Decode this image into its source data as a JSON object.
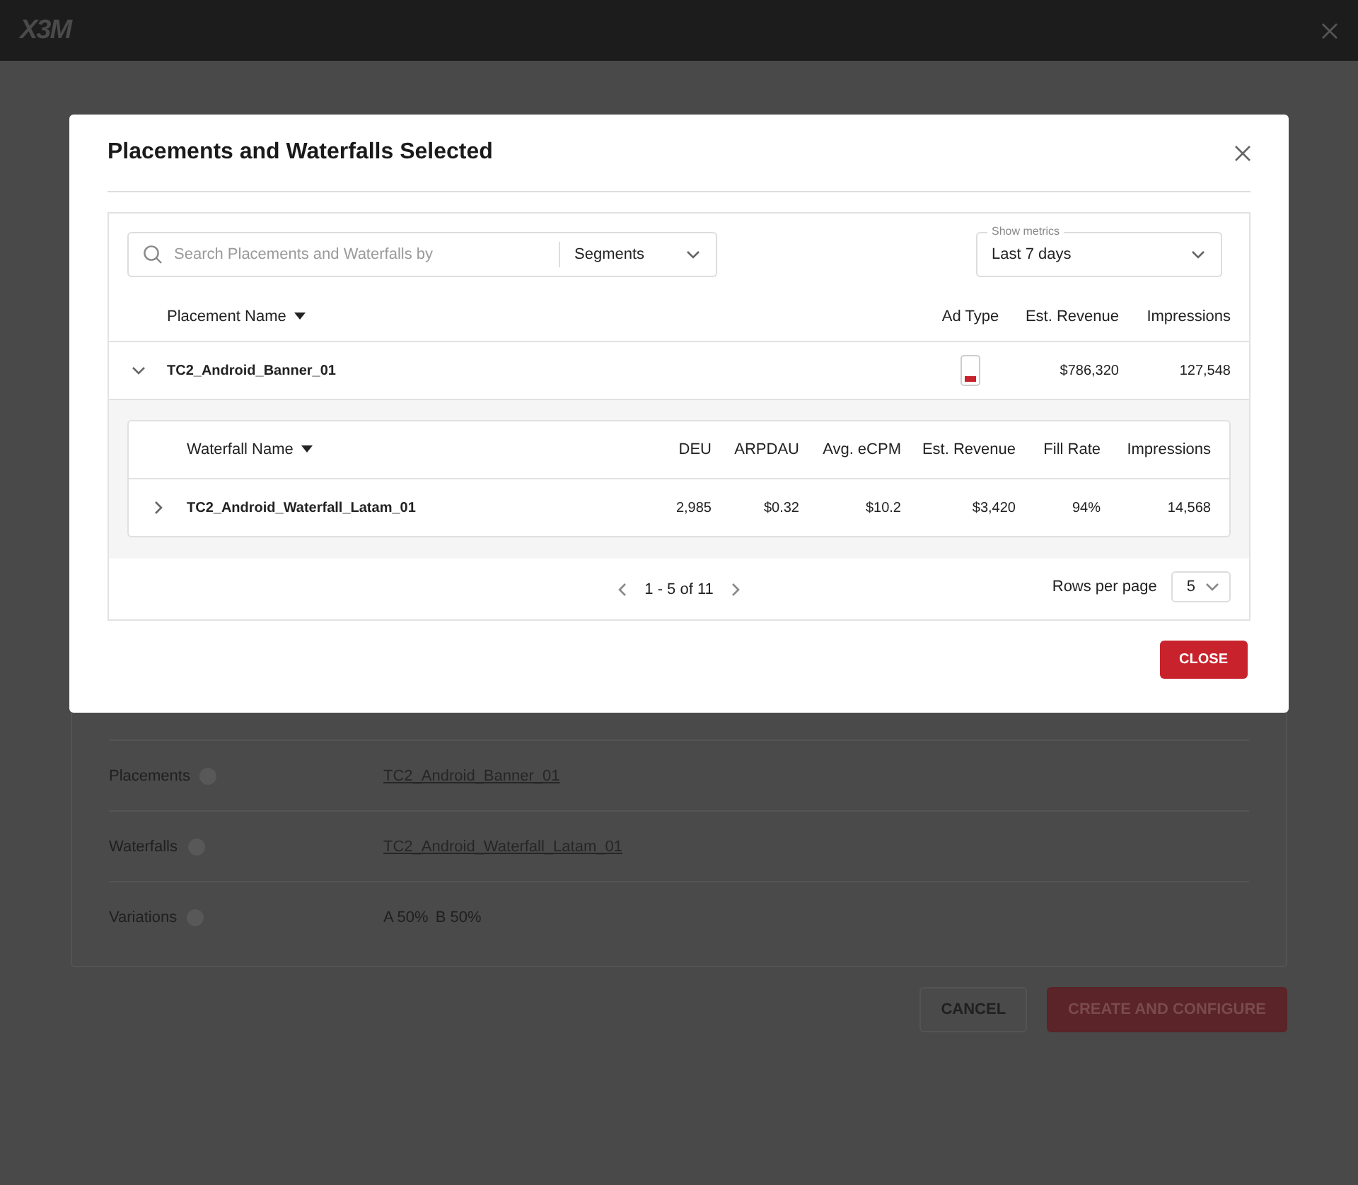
{
  "app": {
    "logo": "X3M"
  },
  "page": {
    "summary": [
      {
        "label": "Placements",
        "link": true,
        "values": [
          "TC2_Android_Banner_01"
        ]
      },
      {
        "label": "Waterfalls",
        "link": true,
        "values": [
          "TC2_Android_Waterfall_Latam_01"
        ]
      },
      {
        "label": "Variations",
        "link": false,
        "values": [
          "A 50%",
          "B 50%"
        ]
      }
    ],
    "buttons": [
      {
        "label": "CANCEL",
        "kind": "secondary"
      },
      {
        "label": "CREATE AND CONFIGURE",
        "kind": "primary"
      }
    ]
  },
  "dialog": {
    "title": "Placements and Waterfalls Selected",
    "search": {
      "placeholder": "Search Placements and Waterfalls by",
      "segment": "Segments"
    },
    "metrics": {
      "label": "Show metrics",
      "value": "Last 7 days"
    },
    "placements": {
      "columns": [
        {
          "label": "Placement Name",
          "sorted": true
        },
        {
          "label": "Ad Type",
          "sorted": false
        },
        {
          "label": "Est. Revenue",
          "sorted": false
        },
        {
          "label": "Impressions",
          "sorted": false
        }
      ],
      "rows": [
        {
          "name": "TC2_Android_Banner_01",
          "expanded": true,
          "kind": "banner",
          "est_revenue": "$786,320",
          "impressions": "127,548",
          "waterfalls": {
            "columns": [
              {
                "label": "Waterfall Name",
                "sorted": true
              },
              {
                "label": "DEU",
                "sorted": false
              },
              {
                "label": "ARPDAU",
                "sorted": false
              },
              {
                "label": "Avg. eCPM",
                "sorted": false
              },
              {
                "label": "Est. Revenue",
                "sorted": false
              },
              {
                "label": "Fill Rate",
                "sorted": false
              },
              {
                "label": "Impressions",
                "sorted": false
              }
            ],
            "rows": [
              {
                "expanded": false,
                "cells": [
                  "TC2_Android_Waterfall_Latam_01",
                  "2,985",
                  "$0.32",
                  "$10.2",
                  "$3,420",
                  "94%",
                  "14,568"
                ]
              }
            ]
          }
        }
      ]
    },
    "pagination": {
      "range": "1 - 5 of 11",
      "rows_per_page_label": "Rows per page",
      "rows_per_page": "5"
    },
    "close_label": "CLOSE"
  }
}
